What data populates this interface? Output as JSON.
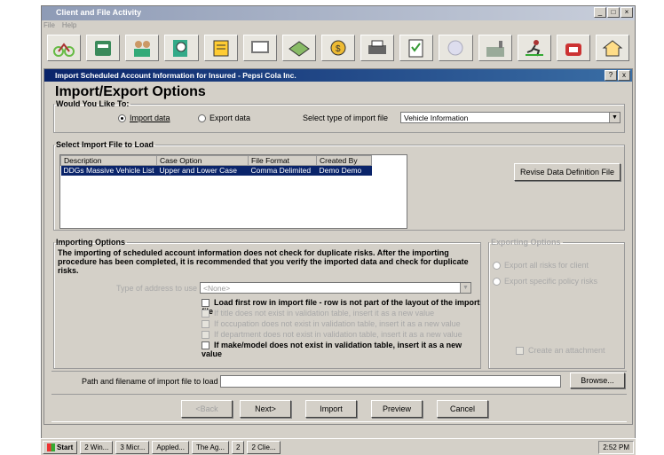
{
  "app": {
    "title": "Client and File Activity",
    "menu": [
      "File",
      "Help"
    ],
    "toolbar_icons": [
      "bicycle-icon",
      "drawer-icon",
      "people-icon",
      "search-doc-icon",
      "note-icon",
      "computer-icon",
      "handshake-icon",
      "coins-icon",
      "printer-icon",
      "checklist-icon",
      "circle-icon",
      "factory-icon",
      "runner-icon",
      "telephone-icon",
      "house-icon"
    ]
  },
  "window": {
    "title": "Import Scheduled Account Information for Insured - Pepsi Cola Inc.",
    "help_btn": "?",
    "close_btn": "x",
    "page_title": "Import/Export Options"
  },
  "would_you": {
    "legend": "Would You Like To:",
    "import_label": "Import data",
    "export_label": "Export data",
    "type_label": "Select type of import file",
    "type_value": "Vehicle Information"
  },
  "select_file": {
    "legend": "Select Import File to Load",
    "columns": [
      "Description",
      "Case Option",
      "File Format",
      "Created By"
    ],
    "rows": [
      [
        "DDGs Massive Vehicle List",
        "Upper and Lower Case",
        "Comma Delimited",
        "Demo Demo"
      ]
    ],
    "revise_button": "Revise Data Definition File"
  },
  "importing": {
    "legend": "Importing Options",
    "note": "The importing of scheduled account information does not check for duplicate risks.  After the importing procedure has been completed, it is recommended that you verify the imported data and check for duplicate risks.",
    "address_label": "Type of address to use",
    "address_value": "<None>",
    "options": [
      "Load first row in import file - row is not part of the layout of the import file",
      "If title does not exist in validation table, insert it as a new value",
      "If occupation does not exist in validation table, insert it as a new value",
      "If department does not exist in validation table, insert it as a new value",
      "If make/model does not exist in validation table, insert it as a new value"
    ]
  },
  "exporting": {
    "legend": "Exporting Options",
    "opt1": "Export all risks for client",
    "opt2": "Export specific policy risks",
    "attach": "Create an attachment"
  },
  "path": {
    "label": "Path and filename of import file to load",
    "value": "",
    "browse": "Browse..."
  },
  "buttons": {
    "back": "<Back",
    "next": "Next>",
    "import": "Import",
    "preview": "Preview",
    "cancel": "Cancel"
  },
  "taskbar": {
    "start": "Start",
    "items": [
      "2 Win...",
      "3 Micr...",
      "Appled...",
      "The Ag...",
      "2",
      "2 Clie..."
    ],
    "clock": "2:52 PM"
  }
}
